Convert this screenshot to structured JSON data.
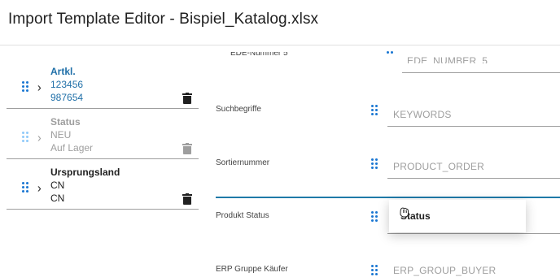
{
  "header": {
    "title": "Import Template Editor - Bispiel_Katalog.xlsx"
  },
  "mapped_list": [
    {
      "title": "Artkl.",
      "values": [
        "123456",
        "987654"
      ],
      "state": "active"
    },
    {
      "title": "Status",
      "values": [
        "NEU",
        "Auf Lager"
      ],
      "state": "dragging-source"
    },
    {
      "title": "Ursprungsland",
      "values": [
        "CN",
        "CN"
      ],
      "state": "normal"
    }
  ],
  "fields": {
    "partial": {
      "label": "EDE-Nummer 5",
      "value": "EDE_NUMBER_5"
    },
    "items": [
      {
        "label": "Suchbegriffe",
        "value": "KEYWORDS"
      },
      {
        "label": "Sortiernummer",
        "value": "PRODUCT_ORDER"
      },
      {
        "label": "Produkt Status",
        "value": ""
      },
      {
        "label": "ERP Gruppe Käufer",
        "value": "ERP_GROUP_BUYER"
      }
    ]
  },
  "drag_preview": {
    "label": "Status"
  },
  "colors": {
    "accent": "#1f6fa8",
    "drag_handle": "#1976d2",
    "drop_indicator": "#1f7aa8"
  },
  "icons": {
    "handle": "drag-handle-icon",
    "expand": "chevron-right-icon",
    "delete": "trash-icon",
    "cursor": "grab-cursor-icon"
  }
}
